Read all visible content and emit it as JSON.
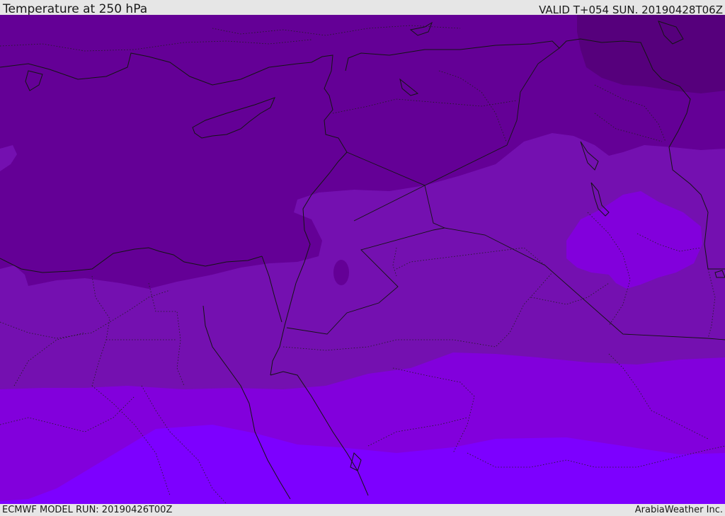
{
  "header": {
    "title": "Temperature at 250 hPa",
    "valid_time": "VALID T+054 SUN. 20190428T06Z"
  },
  "footer": {
    "model_run": "ECMWF MODEL RUN: 20190426T00Z",
    "credit": "ArabiaWeather Inc."
  },
  "map": {
    "field": "temperature",
    "level": "250 hPa",
    "color_bands": [
      {
        "name": "darkest",
        "color": "#56007c"
      },
      {
        "name": "dark",
        "color": "#640096"
      },
      {
        "name": "medium",
        "color": "#7410b0"
      },
      {
        "name": "light",
        "color": "#8200dc"
      },
      {
        "name": "lightest",
        "color": "#7d00ff"
      }
    ],
    "boundary_color": "#141414"
  }
}
